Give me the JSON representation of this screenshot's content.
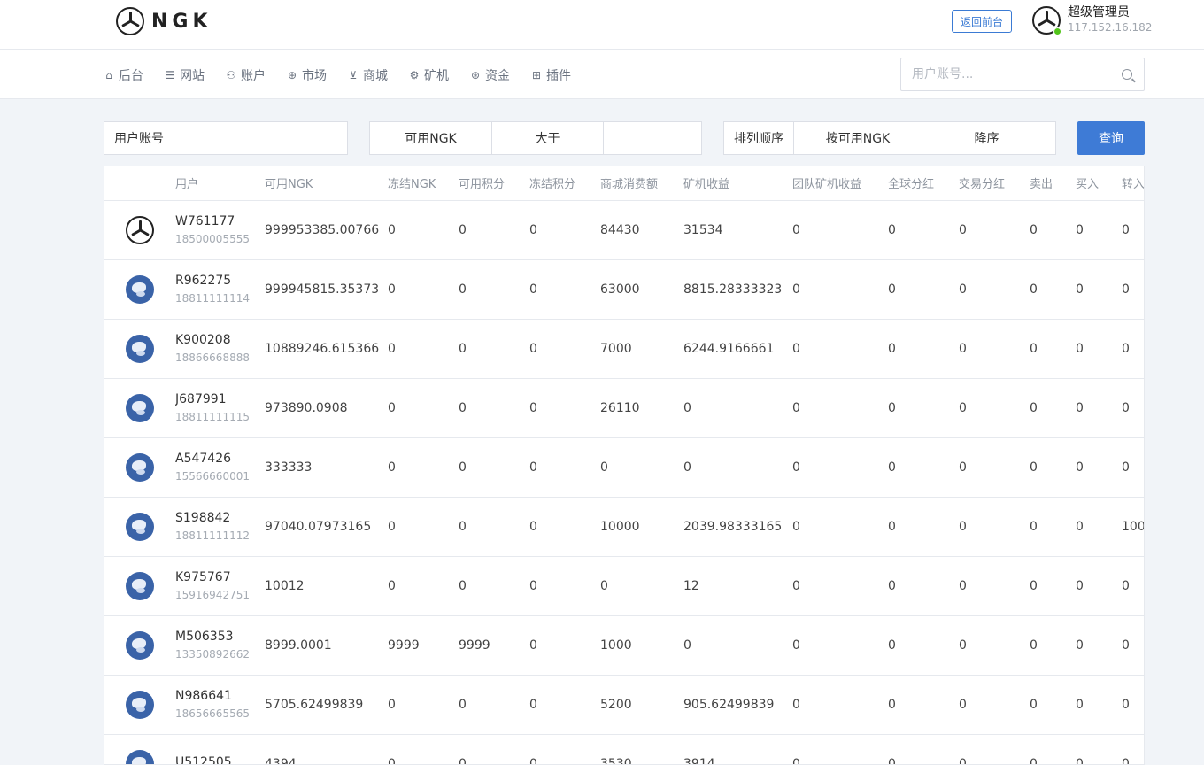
{
  "brand": {
    "name": "NGK"
  },
  "header": {
    "back_label": "返回前台",
    "admin_name": "超级管理员",
    "admin_ip": "117.152.16.182"
  },
  "nav": [
    {
      "label": "后台",
      "icon": "home-icon"
    },
    {
      "label": "网站",
      "icon": "list-icon"
    },
    {
      "label": "账户",
      "icon": "users-icon"
    },
    {
      "label": "市场",
      "icon": "globe-icon"
    },
    {
      "label": "商城",
      "icon": "cart-icon"
    },
    {
      "label": "矿机",
      "icon": "chip-icon"
    },
    {
      "label": "资金",
      "icon": "coin-icon"
    },
    {
      "label": "插件",
      "icon": "grid-icon"
    }
  ],
  "search": {
    "placeholder": "用户账号..."
  },
  "filters": {
    "account_label": "用户账号",
    "account_value": "",
    "field_select": "可用NGK",
    "compare_select": "大于",
    "compare_value": "",
    "sort_label": "排列顺序",
    "sort_field": "按可用NGK",
    "sort_order": "降序",
    "query_label": "查询"
  },
  "table": {
    "headers": [
      "用户",
      "可用NGK",
      "冻结NGK",
      "可用积分",
      "冻结积分",
      "商城消费额",
      "矿机收益",
      "团队矿机收益",
      "全球分红",
      "交易分红",
      "卖出",
      "买入",
      "转入"
    ],
    "rows": [
      {
        "avatar": "ngk-logo",
        "user": "W761177",
        "phone": "18500005555",
        "cells": [
          "999953385.00766",
          "0",
          "0",
          "0",
          "84430",
          "31534",
          "0",
          "0",
          "0",
          "0",
          "0",
          "0"
        ]
      },
      {
        "avatar": "blue-emblem",
        "user": "R962275",
        "phone": "18811111114",
        "cells": [
          "999945815.35373",
          "0",
          "0",
          "0",
          "63000",
          "8815.28333323",
          "0",
          "0",
          "0",
          "0",
          "0",
          "0"
        ]
      },
      {
        "avatar": "blue-emblem",
        "user": "K900208",
        "phone": "18866668888",
        "cells": [
          "10889246.615366",
          "0",
          "0",
          "0",
          "7000",
          "6244.9166661",
          "0",
          "0",
          "0",
          "0",
          "0",
          "0"
        ]
      },
      {
        "avatar": "blue-emblem",
        "user": "J687991",
        "phone": "18811111115",
        "cells": [
          "973890.0908",
          "0",
          "0",
          "0",
          "26110",
          "0",
          "0",
          "0",
          "0",
          "0",
          "0",
          "0"
        ]
      },
      {
        "avatar": "blue-emblem",
        "user": "A547426",
        "phone": "15566660001",
        "cells": [
          "333333",
          "0",
          "0",
          "0",
          "0",
          "0",
          "0",
          "0",
          "0",
          "0",
          "0",
          "0"
        ]
      },
      {
        "avatar": "blue-emblem",
        "user": "S198842",
        "phone": "18811111112",
        "cells": [
          "97040.07973165",
          "0",
          "0",
          "0",
          "10000",
          "2039.98333165",
          "0",
          "0",
          "0",
          "0",
          "0",
          "100"
        ]
      },
      {
        "avatar": "blue-emblem",
        "user": "K975767",
        "phone": "15916942751",
        "cells": [
          "10012",
          "0",
          "0",
          "0",
          "0",
          "12",
          "0",
          "0",
          "0",
          "0",
          "0",
          "0"
        ]
      },
      {
        "avatar": "blue-emblem",
        "user": "M506353",
        "phone": "13350892662",
        "cells": [
          "8999.0001",
          "9999",
          "9999",
          "0",
          "1000",
          "0",
          "0",
          "0",
          "0",
          "0",
          "0",
          "0"
        ]
      },
      {
        "avatar": "blue-emblem",
        "user": "N986641",
        "phone": "18656665565",
        "cells": [
          "5705.62499839",
          "0",
          "0",
          "0",
          "5200",
          "905.62499839",
          "0",
          "0",
          "0",
          "0",
          "0",
          "0"
        ]
      },
      {
        "avatar": "blue-emblem",
        "user": "U512505",
        "phone": "",
        "cells": [
          "4394",
          "0",
          "0",
          "0",
          "3530",
          "3914",
          "0",
          "0",
          "0",
          "0",
          "0",
          "0"
        ]
      }
    ]
  }
}
